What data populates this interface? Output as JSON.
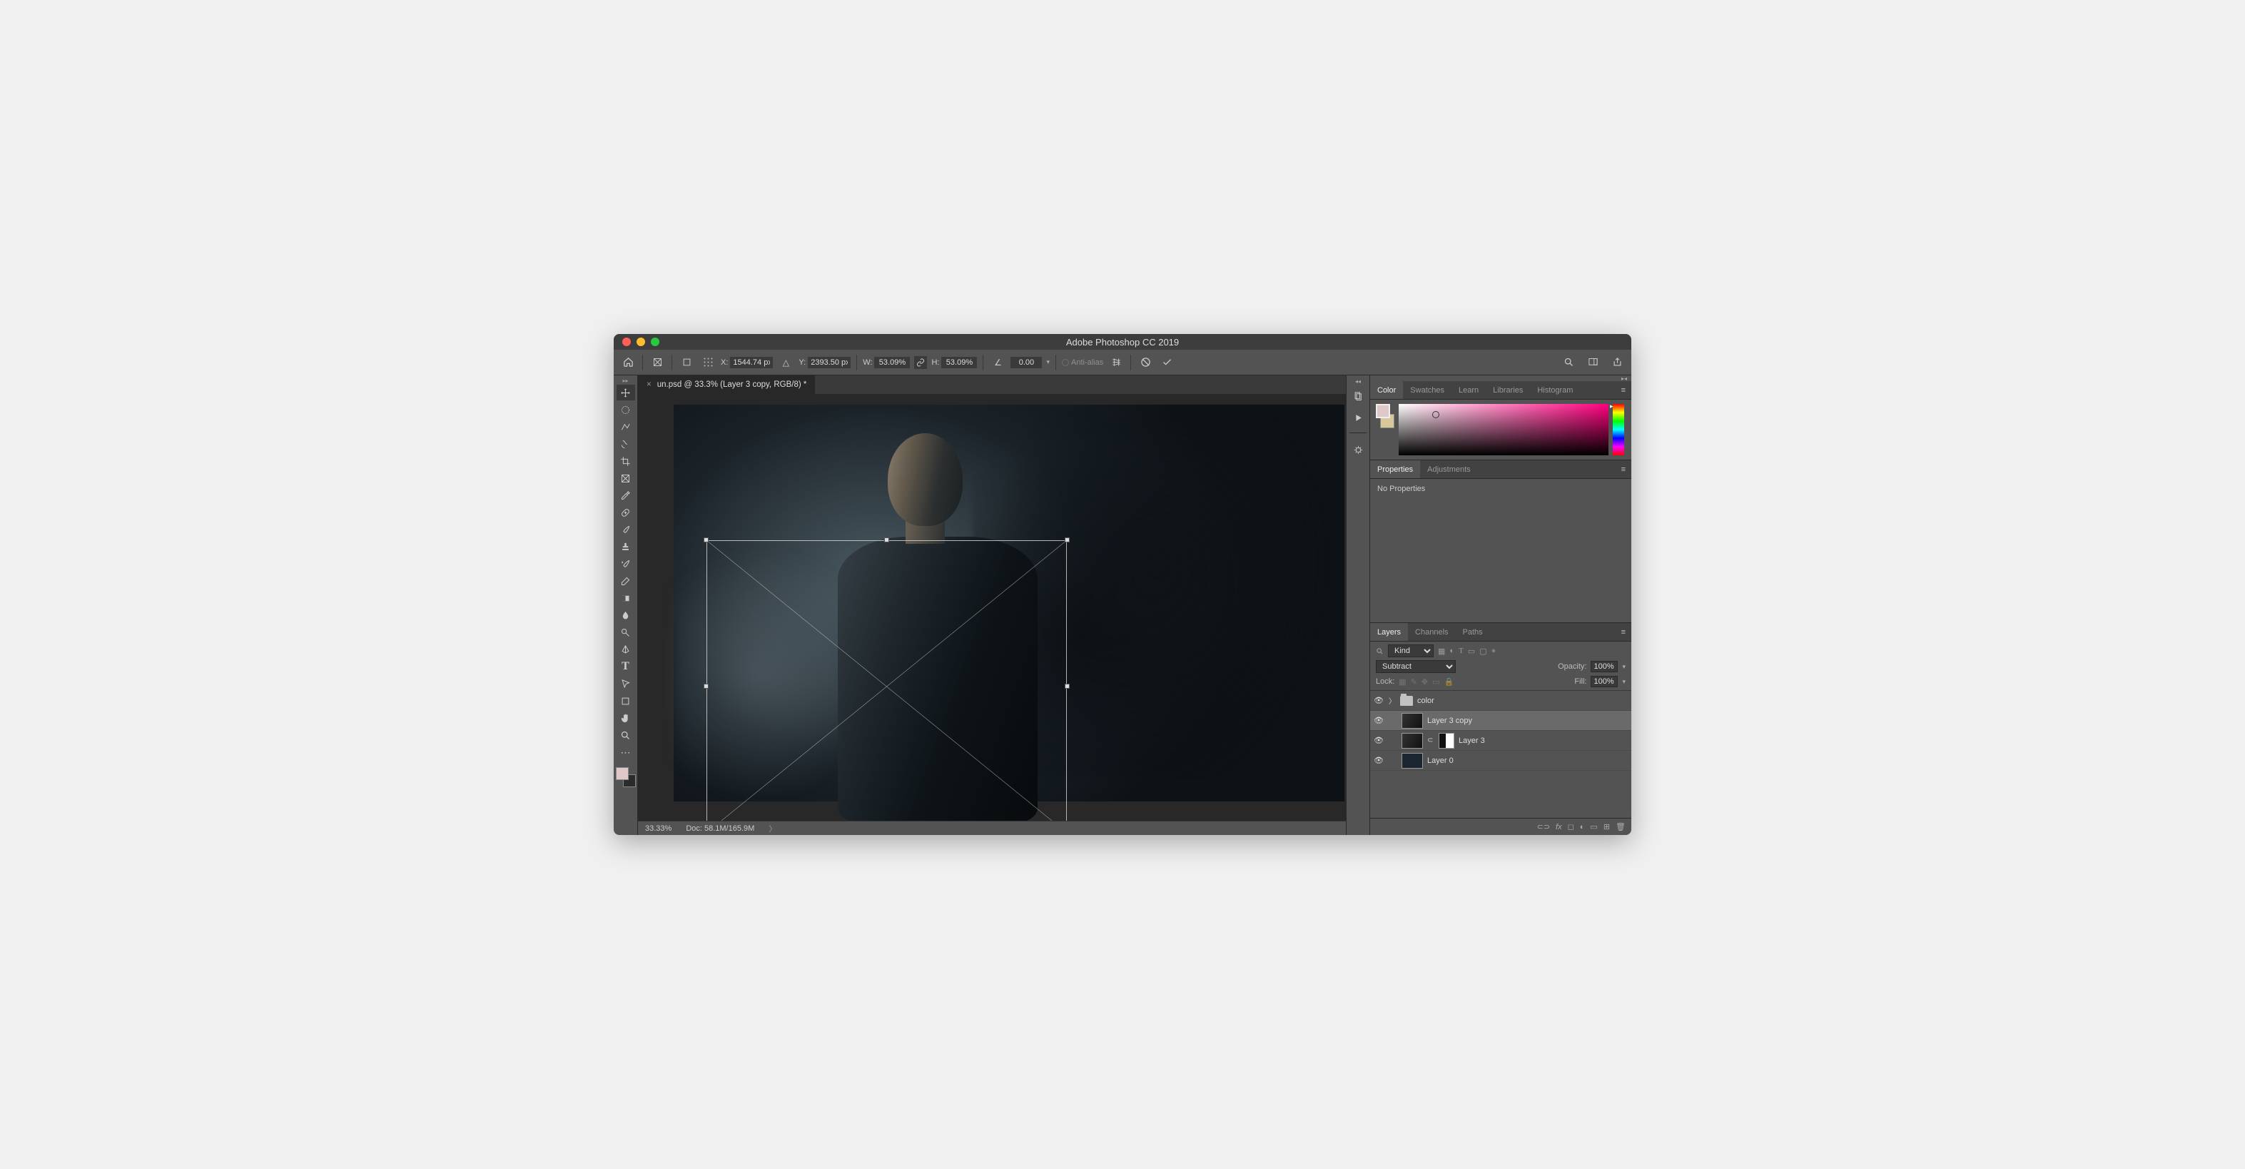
{
  "window": {
    "title": "Adobe Photoshop CC 2019"
  },
  "options": {
    "x_label": "X:",
    "x": "1544.74 px",
    "y_label": "Y:",
    "y": "2393.50 px",
    "w_label": "W:",
    "w": "53.09%",
    "h_label": "H:",
    "h": "53.09%",
    "angle": "0.00",
    "antialias": "Anti-alias"
  },
  "document": {
    "tab": "un.psd @ 33.3% (Layer 3 copy, RGB/8) *",
    "zoom": "33.33%",
    "doc_info": "Doc: 58.1M/165.9M"
  },
  "panels": {
    "color_tabs": [
      "Color",
      "Swatches",
      "Learn",
      "Libraries",
      "Histogram"
    ],
    "props_tabs": [
      "Properties",
      "Adjustments"
    ],
    "props_body": "No Properties",
    "layers_tabs": [
      "Layers",
      "Channels",
      "Paths"
    ]
  },
  "layers": {
    "kind_label": "Kind",
    "blend": "Subtract",
    "opacity_label": "Opacity:",
    "opacity": "100%",
    "lock_label": "Lock:",
    "fill_label": "Fill:",
    "fill": "100%",
    "items": [
      {
        "name": "color"
      },
      {
        "name": "Layer 3 copy"
      },
      {
        "name": "Layer 3"
      },
      {
        "name": "Layer 0"
      }
    ],
    "bottom_icons_fx": "fx"
  }
}
